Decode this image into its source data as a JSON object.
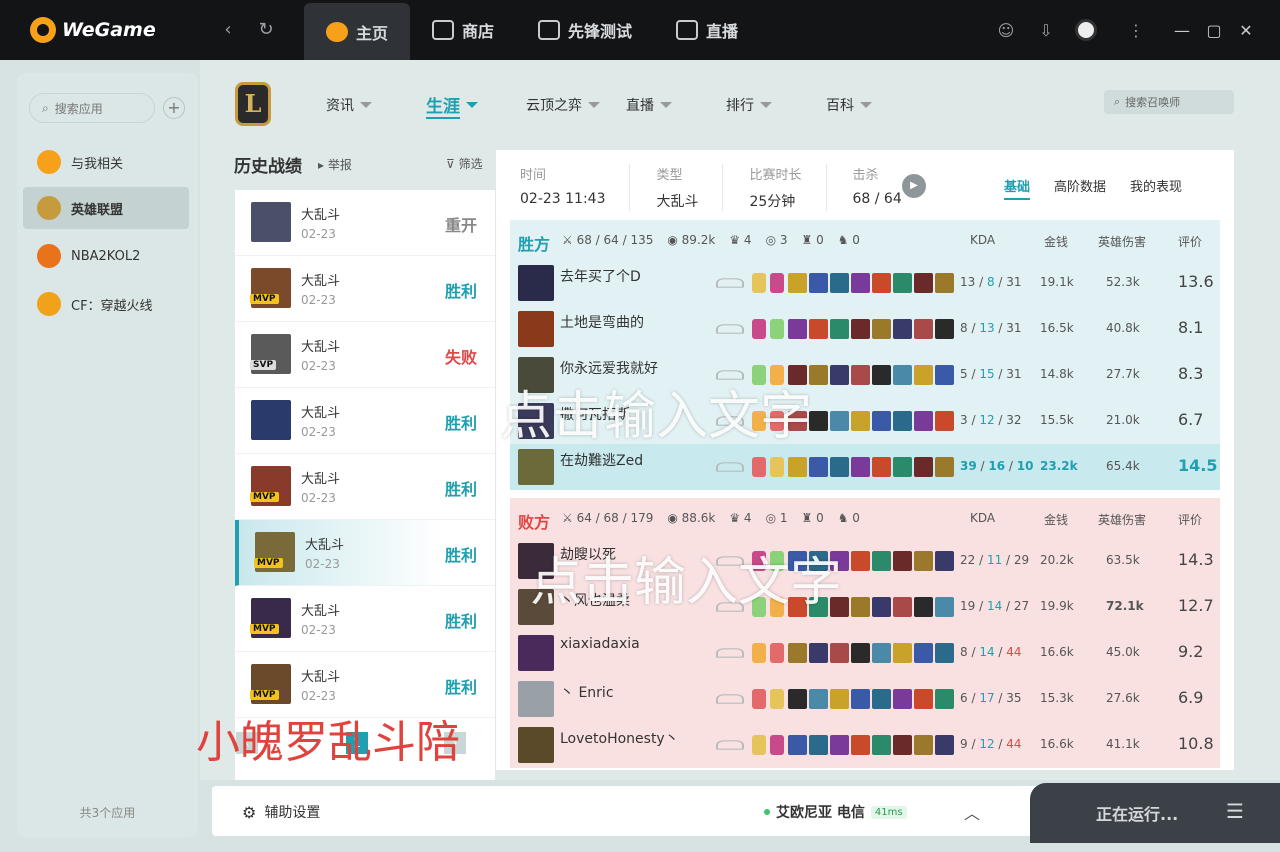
{
  "app": {
    "name": "WeGame",
    "tabs": [
      {
        "label": "主页",
        "active": true
      },
      {
        "label": "商店"
      },
      {
        "label": "先锋测试"
      },
      {
        "label": "直播"
      }
    ]
  },
  "sidebar": {
    "search_placeholder": "搜索应用",
    "items": [
      {
        "label": "与我相关",
        "color": "#f7a11a"
      },
      {
        "label": "英雄联盟",
        "active": true,
        "color": "#c59b3d"
      },
      {
        "label": "NBA2KOL2",
        "color": "#e8731b"
      },
      {
        "label": "CF：穿越火线",
        "color": "#f0a21a"
      }
    ],
    "count": "共3个应用"
  },
  "nav": {
    "logo": "L",
    "items": [
      "资讯",
      "生涯",
      "云顶之弈",
      "直播",
      "排行",
      "百科"
    ],
    "active_index": 1,
    "search_placeholder": "搜索召唤师"
  },
  "history": {
    "title": "历史战绩",
    "report": "举报",
    "filter": "筛选",
    "rows": [
      {
        "mode": "大乱斗",
        "date": "02-23",
        "result": "重开",
        "kind": "remake",
        "badge": "",
        "color": "#4a4f6a"
      },
      {
        "mode": "大乱斗",
        "date": "02-23",
        "result": "胜利",
        "kind": "win",
        "badge": "MVP",
        "color": "#7a4a2a"
      },
      {
        "mode": "大乱斗",
        "date": "02-23",
        "result": "失败",
        "kind": "lose",
        "badge": "SVP",
        "color": "#5a5a5a"
      },
      {
        "mode": "大乱斗",
        "date": "02-23",
        "result": "胜利",
        "kind": "win",
        "badge": "",
        "color": "#2a3a6a"
      },
      {
        "mode": "大乱斗",
        "date": "02-23",
        "result": "胜利",
        "kind": "win",
        "badge": "MVP",
        "color": "#8a3a2a"
      },
      {
        "mode": "大乱斗",
        "date": "02-23",
        "result": "胜利",
        "kind": "win",
        "badge": "MVP",
        "color": "#7a6a3a",
        "selected": true
      },
      {
        "mode": "大乱斗",
        "date": "02-23",
        "result": "胜利",
        "kind": "win",
        "badge": "MVP",
        "color": "#3a2a4a"
      },
      {
        "mode": "大乱斗",
        "date": "02-23",
        "result": "胜利",
        "kind": "win",
        "badge": "MVP",
        "color": "#6a4a2a"
      }
    ]
  },
  "pager": {
    "active": "1"
  },
  "detail": {
    "info": [
      {
        "k": "时间",
        "v": "02-23 11:43"
      },
      {
        "k": "类型",
        "v": "大乱斗"
      },
      {
        "k": "比赛时长",
        "v": "25分钟"
      },
      {
        "k": "击杀",
        "v": "68 / 64"
      }
    ],
    "tabs": [
      "基础",
      "高阶数据",
      "我的表现"
    ],
    "cols": {
      "kda": "KDA",
      "gold": "金钱",
      "dmg": "英雄伤害",
      "score": "评价"
    },
    "teams": [
      {
        "name": "胜方",
        "cls": "win",
        "stats": [
          "68 / 64 / 135",
          "89.2k",
          "4",
          "3",
          "0",
          "0"
        ],
        "players": [
          {
            "name": "去年买了个D",
            "k": "13",
            "d": "8",
            "a": "31",
            "gold": "19.1k",
            "dmg": "52.3k",
            "score": "13.6",
            "color": "#2a2a4a"
          },
          {
            "name": "土地是弯曲的",
            "k": "8",
            "d": "13",
            "a": "31",
            "gold": "16.5k",
            "dmg": "40.8k",
            "score": "8.1",
            "color": "#8a3a1a"
          },
          {
            "name": "你永远爱我就好",
            "k": "5",
            "d": "15",
            "a": "31",
            "gold": "14.8k",
            "dmg": "27.7k",
            "score": "8.3",
            "color": "#4a4a3a"
          },
          {
            "name": "撒何瓦拓斯",
            "k": "3",
            "d": "12",
            "a": "32",
            "gold": "15.5k",
            "dmg": "21.0k",
            "score": "6.7",
            "color": "#3a3a5a"
          },
          {
            "name": "在劫難逃Zed",
            "k": "39",
            "d": "16",
            "a": "10",
            "gold": "23.2k",
            "dmg": "65.4k",
            "score": "14.5",
            "color": "#6a6a3a",
            "me": true
          }
        ]
      },
      {
        "name": "败方",
        "cls": "lose",
        "stats": [
          "64 / 68 / 179",
          "88.6k",
          "4",
          "1",
          "0",
          "0"
        ],
        "players": [
          {
            "name": "劫瞍以死",
            "k": "22",
            "d": "11",
            "a": "29",
            "gold": "20.2k",
            "dmg": "63.5k",
            "score": "14.3",
            "color": "#3a2a3a"
          },
          {
            "name": "丶风也温柔",
            "k": "19",
            "d": "14",
            "a": "27",
            "gold": "19.9k",
            "dmg": "72.1k",
            "score": "12.7",
            "color": "#5a4a3a",
            "dmg_hi": true
          },
          {
            "name": "xiaxiadaxia",
            "k": "8",
            "d": "14",
            "a": "44",
            "gold": "16.6k",
            "dmg": "45.0k",
            "score": "9.2",
            "color": "#4a2a5a",
            "a_hi": true
          },
          {
            "name": "丶 Enric",
            "k": "6",
            "d": "17",
            "a": "35",
            "gold": "15.3k",
            "dmg": "27.6k",
            "score": "6.9",
            "color": "#9aa0a8"
          },
          {
            "name": "LovetoHonesty丶",
            "k": "9",
            "d": "12",
            "a": "44",
            "gold": "16.6k",
            "dmg": "41.1k",
            "score": "10.8",
            "color": "#5a4a2a",
            "a_hi": true
          }
        ]
      }
    ]
  },
  "overlays": {
    "text1": "点击输入文字",
    "text2": "点击输入文字",
    "watermark": "小魄罗乱斗陪"
  },
  "bottom": {
    "assist": "辅助设置",
    "server": "艾欧尼亚 电信",
    "ping": "41ms",
    "running": "正在运行..."
  }
}
